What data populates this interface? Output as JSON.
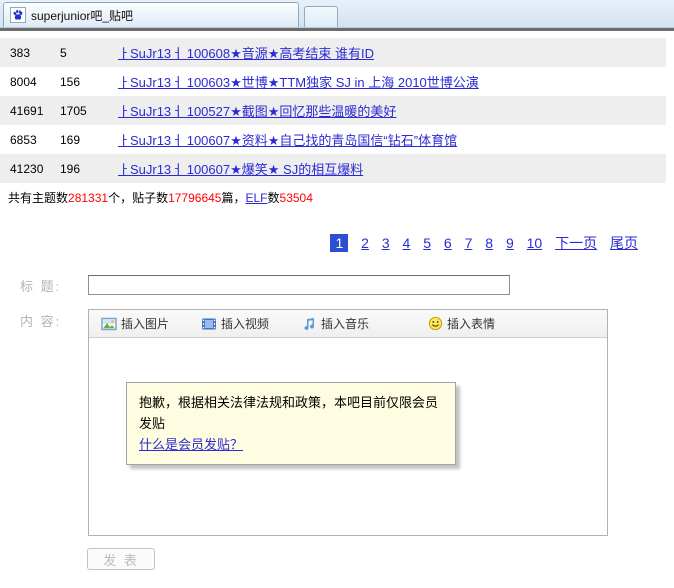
{
  "tab": {
    "title": "superjunior吧_贴吧",
    "favicon": "baidu-paw-icon"
  },
  "threads": {
    "rows": [
      {
        "views": "383",
        "replies": "5",
        "title": "ㅏSuJr13ㅓ 100608★音源★高考结束  谁有ID"
      },
      {
        "views": "8004",
        "replies": "156",
        "title": "ㅏSuJr13ㅓ 100603★世博★TTM独家  SJ in 上海  2010世博公演"
      },
      {
        "views": "41691",
        "replies": "1705",
        "title": "ㅏSuJr13ㅓ 100527★截图★回忆那些温暖的美好"
      },
      {
        "views": "6853",
        "replies": "169",
        "title": "ㅏSuJr13ㅓ 100607★资料★自己找的青岛国信“钻石”体育馆"
      },
      {
        "views": "41230",
        "replies": "196",
        "title": "ㅏSuJr13ㅓ 100607★爆笑★ SJ的相互爆料"
      }
    ]
  },
  "stats": {
    "label_topics": "共有主题数",
    "topics_count": "281331",
    "label_posts": "个，贴子数",
    "posts_count": "17796645",
    "label_elf_pre": "篇，",
    "elf_link": "ELF",
    "label_elf_post": "数",
    "elf_count": "53504"
  },
  "pagination": {
    "current": "1",
    "pages": [
      "2",
      "3",
      "4",
      "5",
      "6",
      "7",
      "8",
      "9",
      "10"
    ],
    "next_label": "下一页",
    "last_label": "尾页"
  },
  "form": {
    "title_label": "标 题:",
    "title_value": "",
    "content_label": "内 容:",
    "toolbar": [
      {
        "icon": "image-icon",
        "label": "插入图片"
      },
      {
        "icon": "video-icon",
        "label": "插入视频"
      },
      {
        "icon": "music-icon",
        "label": "插入音乐"
      },
      {
        "icon": "emoticon-icon",
        "label": "插入表情"
      }
    ],
    "notice": {
      "message": "抱歉，根据相关法律法规和政策，本吧目前仅限会员发贴",
      "link_label": "什么是会员发贴？"
    },
    "submit_label": "发 表"
  },
  "colors": {
    "link_blue": "#2b2bd5",
    "count_red": "#ff0000",
    "page_active_bg": "#2b4fd0",
    "notice_bg": "#fffde1",
    "row_alt_gray": "#eeeeee"
  }
}
